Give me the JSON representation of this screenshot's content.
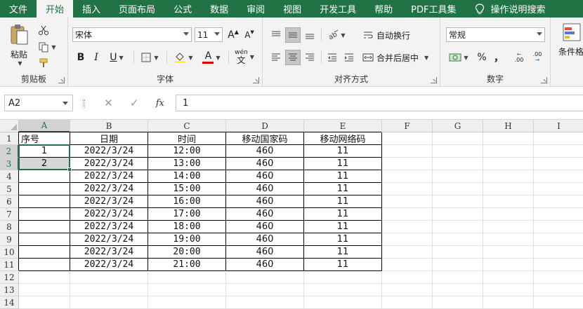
{
  "menu": {
    "tabs": [
      "文件",
      "开始",
      "插入",
      "页面布局",
      "公式",
      "数据",
      "审阅",
      "视图",
      "开发工具",
      "帮助",
      "PDF工具集"
    ],
    "active_index": 1,
    "search_label": "操作说明搜索"
  },
  "ribbon": {
    "clipboard": {
      "label": "剪贴板",
      "paste": "粘贴"
    },
    "font": {
      "label": "字体",
      "name": "宋体",
      "size": "11",
      "bold": "B",
      "italic": "I",
      "underline": "U",
      "grow": "A",
      "shrink": "A",
      "font_color": "A",
      "phonetic": "wén"
    },
    "alignment": {
      "label": "对齐方式",
      "wrap_text": "自动换行",
      "merge_center": "合并后居中"
    },
    "number": {
      "label": "数字",
      "format": "常规",
      "percent": "%",
      "comma": "，",
      "inc_decimal": ".00",
      "dec_decimal": ".00"
    },
    "styles": {
      "cond_format": "条件格"
    }
  },
  "formula_bar": {
    "name_box": "A2",
    "cancel_glyph": "✕",
    "enter_glyph": "✓",
    "fx_label": "fx",
    "value": "1"
  },
  "grid": {
    "columns": [
      "A",
      "B",
      "C",
      "D",
      "E",
      "F",
      "G",
      "H",
      "I"
    ],
    "rows": [
      "1",
      "2",
      "3",
      "4",
      "5",
      "6",
      "7",
      "8",
      "9",
      "10",
      "11",
      "12",
      "13",
      "14"
    ],
    "headers": [
      "序号",
      "日期",
      "时间",
      "移动国家码",
      "移动网络码"
    ],
    "data": [
      [
        "1",
        "2022/3/24",
        "12:00",
        "460",
        "11"
      ],
      [
        "2",
        "2022/3/24",
        "13:00",
        "460",
        "11"
      ],
      [
        "",
        "2022/3/24",
        "14:00",
        "460",
        "11"
      ],
      [
        "",
        "2022/3/24",
        "15:00",
        "460",
        "11"
      ],
      [
        "",
        "2022/3/24",
        "16:00",
        "460",
        "11"
      ],
      [
        "",
        "2022/3/24",
        "17:00",
        "460",
        "11"
      ],
      [
        "",
        "2022/3/24",
        "18:00",
        "460",
        "11"
      ],
      [
        "",
        "2022/3/24",
        "19:00",
        "460",
        "11"
      ],
      [
        "",
        "2022/3/24",
        "20:00",
        "460",
        "11"
      ],
      [
        "",
        "2022/3/24",
        "21:00",
        "460",
        "11"
      ]
    ],
    "selected_cell": "A2",
    "selected_range": "A2:A3"
  },
  "colors": {
    "accent": "#217346",
    "ribbon_bg": "#f3f3f3",
    "header_bg": "#efefef",
    "selection_fill": "#d6d6d6"
  }
}
